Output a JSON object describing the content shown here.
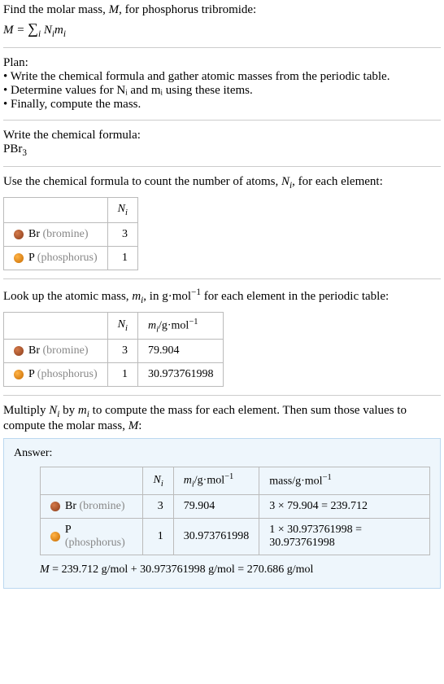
{
  "intro": {
    "line1_a": "Find the molar mass, ",
    "line1_b": ", for phosphorus tribromide:",
    "formula_lhs": "M = ",
    "formula_sum": "∑",
    "formula_sub": "i",
    "formula_rhs_a": " N",
    "formula_rhs_b": "m"
  },
  "plan": {
    "heading": "Plan:",
    "items": [
      "Write the chemical formula and gather atomic masses from the periodic table.",
      "Determine values for Nᵢ and mᵢ using these items.",
      "Finally, compute the mass."
    ]
  },
  "chem_formula": {
    "heading": "Write the chemical formula:",
    "formula_a": "PBr",
    "formula_sub": "3"
  },
  "count_section": {
    "text_a": "Use the chemical formula to count the number of atoms, ",
    "text_b": ", for each element:",
    "header_n": "N",
    "header_n_sub": "i",
    "rows": [
      {
        "sym": "Br",
        "name": "(bromine)",
        "n": "3",
        "swatch": "sw-br"
      },
      {
        "sym": "P",
        "name": "(phosphorus)",
        "n": "1",
        "swatch": "sw-p"
      }
    ]
  },
  "mass_section": {
    "text_a": "Look up the atomic mass, ",
    "text_b": ", in g·mol",
    "text_c": " for each element in the periodic table:",
    "header_m": "m",
    "header_m_sub": "i",
    "unit_sup": "−1",
    "unit": "/g·mol",
    "rows": [
      {
        "sym": "Br",
        "name": "(bromine)",
        "n": "3",
        "m": "79.904",
        "swatch": "sw-br"
      },
      {
        "sym": "P",
        "name": "(phosphorus)",
        "n": "1",
        "m": "30.973761998",
        "swatch": "sw-p"
      }
    ]
  },
  "multiply_section": {
    "text_a": "Multiply ",
    "text_b": " by ",
    "text_c": " to compute the mass for each element. Then sum those values to compute the molar mass, ",
    "text_d": ":"
  },
  "answer": {
    "label": "Answer:",
    "mass_header": "mass/g·mol",
    "rows": [
      {
        "sym": "Br",
        "name": "(bromine)",
        "n": "3",
        "m": "79.904",
        "mass": "3 × 79.904 = 239.712",
        "swatch": "sw-br"
      },
      {
        "sym": "P",
        "name": "(phosphorus)",
        "n": "1",
        "m": "30.973761998",
        "mass": "1 × 30.973761998 = 30.973761998",
        "swatch": "sw-p"
      }
    ],
    "final_a": "M",
    "final_b": " = 239.712 g/mol + 30.973761998 g/mol = 270.686 g/mol"
  },
  "symbols": {
    "M": "M",
    "N": "N",
    "i": "i",
    "m": "m"
  }
}
